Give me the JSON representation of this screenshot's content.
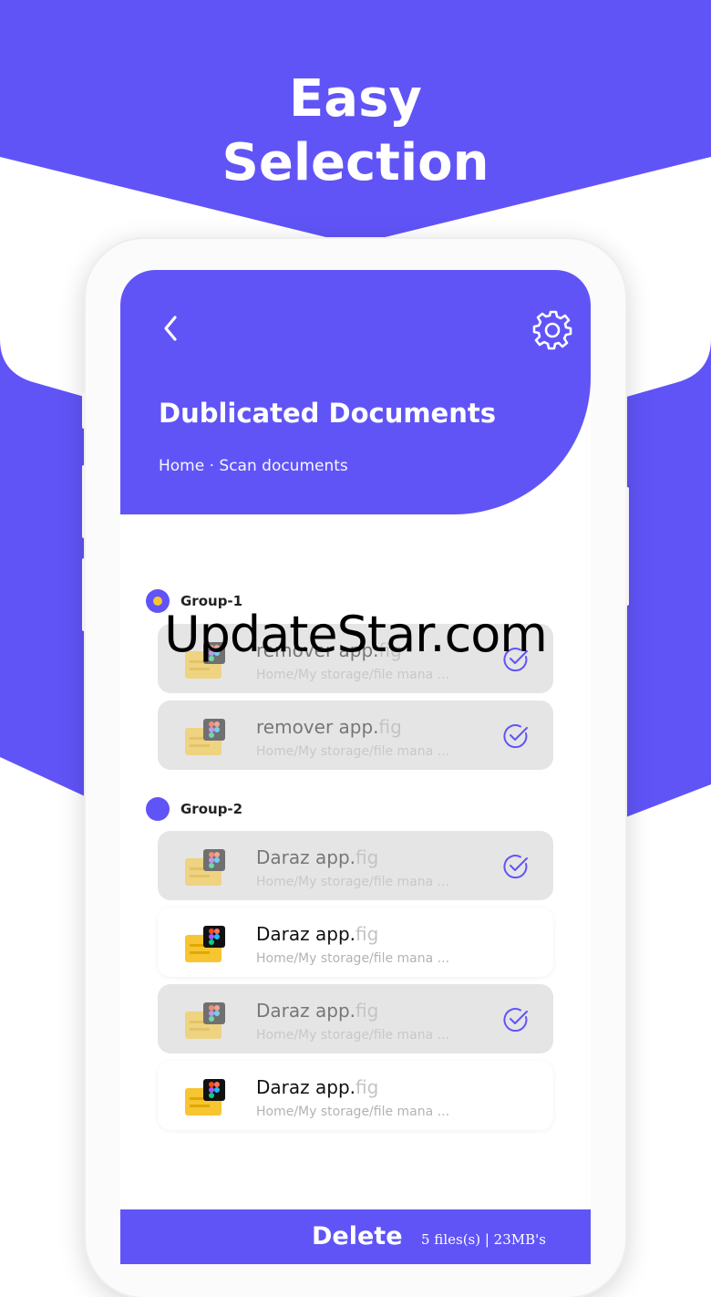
{
  "colors": {
    "brand": "#6054f7",
    "accent_yellow": "#f7c531",
    "white": "#ffffff"
  },
  "promo": {
    "line1": "Easy",
    "line2": "Selection"
  },
  "header": {
    "title": "Dublicated Documents",
    "breadcrumb": "Home · Scan documents",
    "back_icon": "chevron-left-icon",
    "settings_icon": "gear-icon"
  },
  "groups": [
    {
      "label": "Group-1",
      "files": [
        {
          "name": "remover app.",
          "ext": "fig",
          "path": "Home/My storage/file mana ...",
          "selected": true
        },
        {
          "name": "remover app.",
          "ext": "fig",
          "path": "Home/My storage/file mana ...",
          "selected": true
        }
      ]
    },
    {
      "label": "Group-2",
      "files": [
        {
          "name": "Daraz app.",
          "ext": "fig",
          "path": "Home/My storage/file mana ...",
          "selected": true
        },
        {
          "name": "Daraz app.",
          "ext": "fig",
          "path": "Home/My storage/file mana ...",
          "selected": false
        },
        {
          "name": "Daraz app.",
          "ext": "fig",
          "path": "Home/My storage/file mana ...",
          "selected": true
        },
        {
          "name": "Daraz app.",
          "ext": "fig",
          "path": "Home/My storage/file mana ...",
          "selected": false
        }
      ]
    }
  ],
  "footer": {
    "delete_label": "Delete",
    "summary": "5 files(s) | 23MB's"
  },
  "watermark": "UpdateStar.com"
}
